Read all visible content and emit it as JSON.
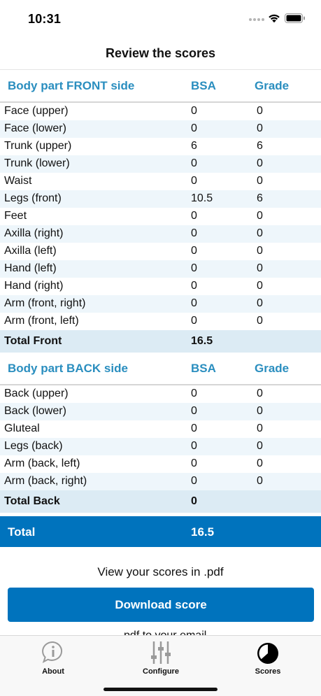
{
  "status_bar": {
    "time": "10:31"
  },
  "header": {
    "title": "Review the scores"
  },
  "front": {
    "columns": [
      "Body part FRONT side",
      "BSA",
      "Grade"
    ],
    "rows": [
      [
        "Face (upper)",
        "0",
        "0"
      ],
      [
        "Face (lower)",
        "0",
        "0"
      ],
      [
        "Trunk (upper)",
        "6",
        "6"
      ],
      [
        "Trunk (lower)",
        "0",
        "0"
      ],
      [
        "Waist",
        "0",
        "0"
      ],
      [
        "Legs (front)",
        "10.5",
        "6"
      ],
      [
        "Feet",
        "0",
        "0"
      ],
      [
        "Axilla (right)",
        "0",
        "0"
      ],
      [
        "Axilla (left)",
        "0",
        "0"
      ],
      [
        "Hand (left)",
        "0",
        "0"
      ],
      [
        "Hand (right)",
        "0",
        "0"
      ],
      [
        "Arm (front, right)",
        "0",
        "0"
      ],
      [
        "Arm (front, left)",
        "0",
        "0"
      ]
    ],
    "total_label": "Total Front",
    "total_value": "16.5"
  },
  "back": {
    "columns": [
      "Body part BACK side",
      "BSA",
      "Grade"
    ],
    "rows": [
      [
        "Back (upper)",
        "0",
        "0"
      ],
      [
        "Back (lower)",
        "0",
        "0"
      ],
      [
        "Gluteal",
        "0",
        "0"
      ],
      [
        "Legs (back)",
        "0",
        "0"
      ],
      [
        "Arm (back, left)",
        "0",
        "0"
      ],
      [
        "Arm (back, right)",
        "0",
        "0"
      ]
    ],
    "total_label": "Total Back",
    "total_value": "0"
  },
  "grand_total": {
    "label": "Total",
    "value": "16.5"
  },
  "pdf": {
    "text": "View your scores in .pdf",
    "button": "Download score",
    "partial_text": "...pdf to your email"
  },
  "tabs": [
    {
      "label": "About",
      "icon": "info-bubble-icon"
    },
    {
      "label": "Configure",
      "icon": "sliders-icon"
    },
    {
      "label": "Scores",
      "icon": "pie-chart-icon"
    }
  ],
  "colors": {
    "accent": "#0073bd",
    "header_text": "#2a8ebf",
    "row_alt": "#eef6fb",
    "total_row": "#dcebf4"
  }
}
